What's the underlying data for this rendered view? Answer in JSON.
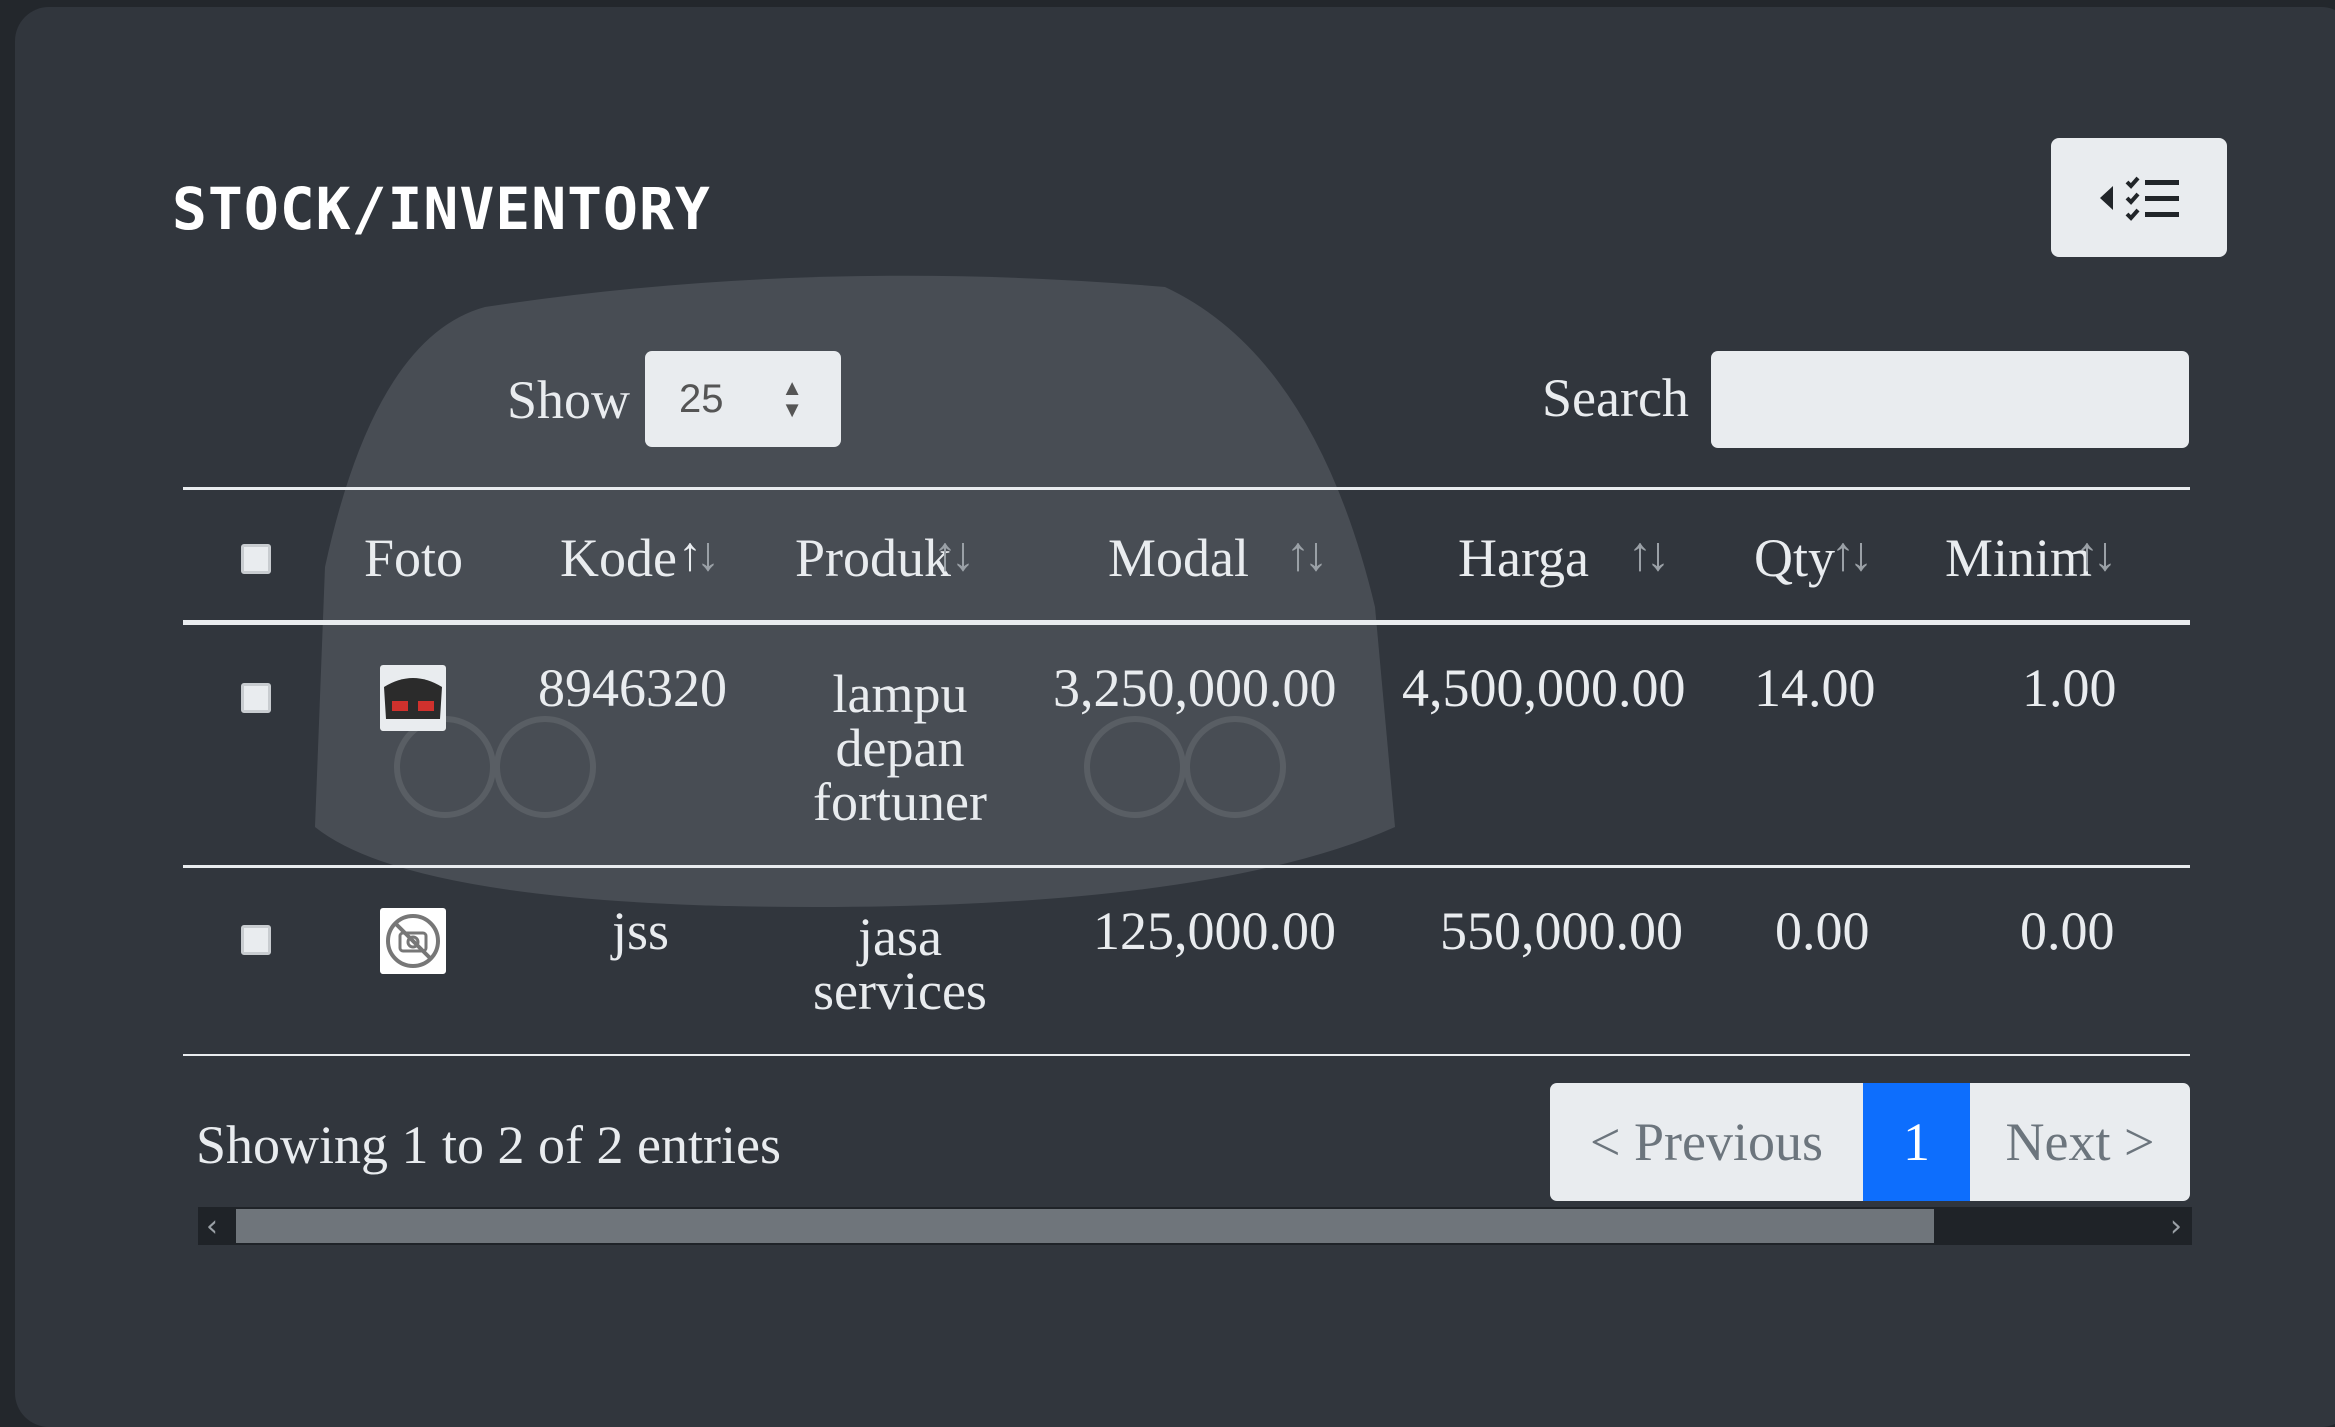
{
  "page": {
    "title": "STOCK/INVENTORY",
    "toggle_icons": {
      "caret": "caret-left-icon",
      "list": "checklist-icon"
    }
  },
  "controls": {
    "show_label": "Show",
    "page_size": "25",
    "search_label": "Search",
    "search_value": ""
  },
  "table": {
    "columns": [
      "Foto",
      "Kode",
      "Produk",
      "Modal",
      "Harga",
      "Qty",
      "Minim"
    ],
    "rows": [
      {
        "foto": "product-photo-icon",
        "kode": "8946320",
        "produk": "lampu depan fortuner",
        "modal": "3,250,000.00",
        "harga": "4,500,000.00",
        "qty": "14.00",
        "minim": "1.00"
      },
      {
        "foto": "no-photo-icon",
        "kode": "jss",
        "produk": "jasa services",
        "modal": "125,000.00",
        "harga": "550,000.00",
        "qty": "0.00",
        "minim": "0.00"
      }
    ]
  },
  "footer": {
    "info": "Showing 1 to 2 of 2 entries",
    "prev": "< Previous",
    "page": "1",
    "next": "Next >"
  },
  "colors": {
    "panel": "#31363d",
    "accent": "#0d6efd",
    "light": "#e9ecef"
  }
}
